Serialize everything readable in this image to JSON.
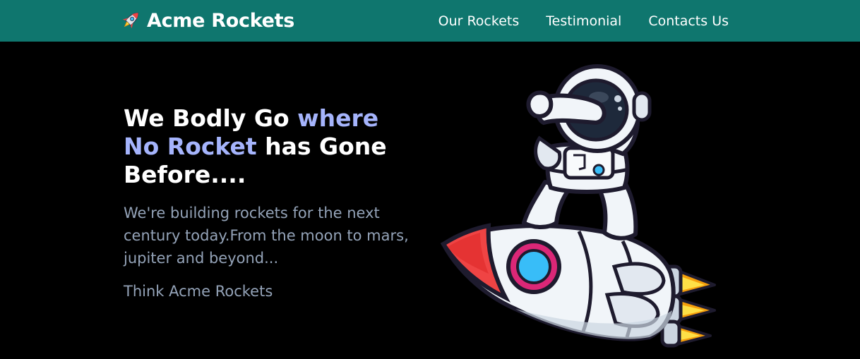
{
  "navbar": {
    "brand": {
      "icon": "rocket-icon",
      "name": "Acme Rockets"
    },
    "links": [
      {
        "label": "Our Rockets"
      },
      {
        "label": "Testimonial"
      },
      {
        "label": "Contacts Us"
      }
    ],
    "background_color": "#0f766e"
  },
  "hero": {
    "headline_part1": "We Bodly Go ",
    "headline_accent": "where No Rocket",
    "headline_part2": " has Gone Before....",
    "subtext": "We're building rockets for the next century today.From the moon to mars, jupiter and beyond...",
    "tagline": "Think Acme Rockets",
    "image": "astronaut-on-rocket-illustration",
    "accent_color": "#a5b4fc",
    "text_color": "#94a3b8"
  }
}
